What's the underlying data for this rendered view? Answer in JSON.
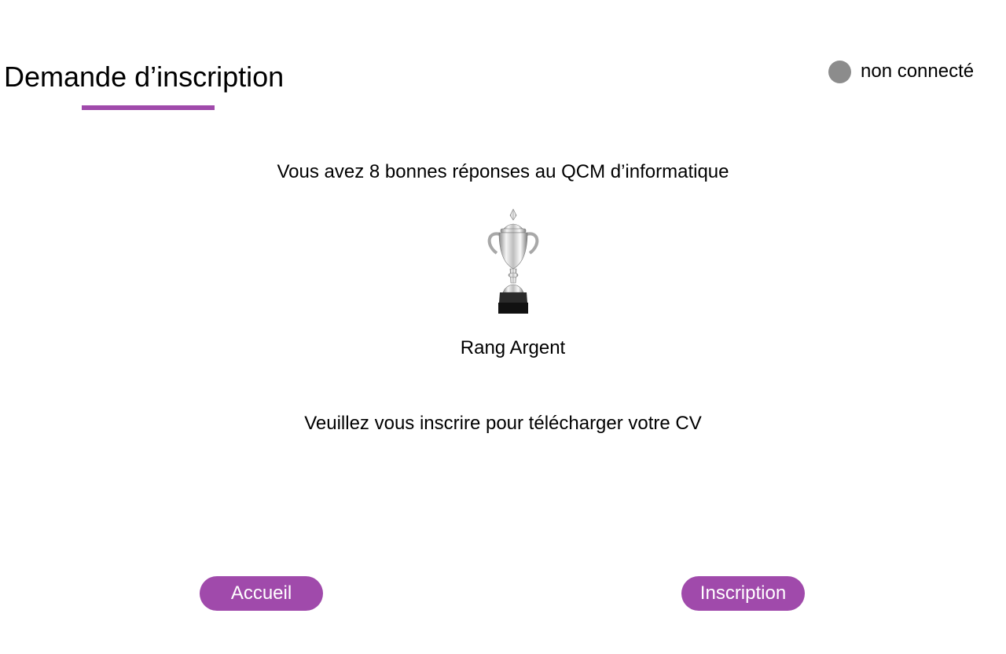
{
  "header": {
    "title": "Demande d’inscription"
  },
  "status": {
    "label": "non connecté",
    "dot_color": "#8c8c8c"
  },
  "main": {
    "score_text": "Vous avez 8 bonnes réponses au QCM d’informatique",
    "trophy_icon": "silver-trophy-icon",
    "rank_text": "Rang Argent",
    "register_prompt": "Veuillez vous inscrire pour télécharger votre CV"
  },
  "buttons": {
    "home_label": "Accueil",
    "register_label": "Inscription"
  },
  "colors": {
    "accent": "#a04aab",
    "text": "#000000",
    "background": "#ffffff"
  }
}
